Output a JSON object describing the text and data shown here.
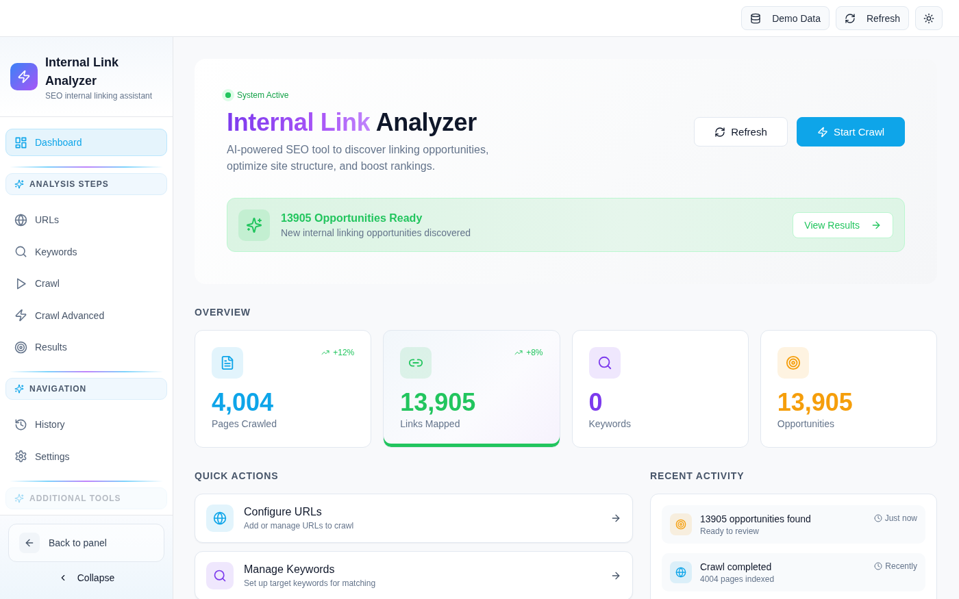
{
  "topbar": {
    "buttons": [
      {
        "kind": "data",
        "label": "Demo Data"
      },
      {
        "kind": "refresh",
        "label": "Refresh"
      },
      {
        "kind": "theme"
      }
    ]
  },
  "sidebar": {
    "brand": {
      "title": "Internal Link Analyzer",
      "subtitle": "SEO internal linking assistant"
    },
    "items": [
      {
        "kind": "dashboard",
        "label": "Dashboard",
        "selected": true
      }
    ],
    "sections": [
      {
        "title": "ANALYSIS STEPS",
        "faded": false,
        "items": [
          {
            "kind": "urls",
            "label": "URLs",
            "selected": false
          },
          {
            "kind": "keywords",
            "label": "Keywords",
            "selected": false
          },
          {
            "kind": "crawl",
            "label": "Crawl",
            "selected": false
          },
          {
            "kind": "crawl_advanced",
            "label": "Crawl Advanced",
            "selected": false
          },
          {
            "kind": "results",
            "label": "Results",
            "selected": false
          }
        ]
      },
      {
        "title": "NAVIGATION",
        "faded": false,
        "items": [
          {
            "kind": "history",
            "label": "History",
            "selected": false
          },
          {
            "kind": "settings",
            "label": "Settings",
            "selected": false
          }
        ]
      },
      {
        "title": "ADDITIONAL TOOLS",
        "faded": true
      }
    ],
    "footer": {
      "back_button": "Back to panel",
      "collapse_button": "Collapse"
    }
  },
  "hero": {
    "status": {
      "label": "System Active",
      "active": true
    },
    "title": {
      "highlight": "Internal Link",
      "rest": "Analyzer"
    },
    "description": "AI-powered SEO tool to discover linking opportunities, optimize site structure, and boost rankings.",
    "buttons": [
      {
        "kind": "secondary",
        "label": "Refresh"
      },
      {
        "kind": "primary",
        "label": "Start Crawl"
      }
    ],
    "banner": {
      "title": "13905 Opportunities Ready",
      "subtitle": "New internal linking opportunities discovered",
      "button": "View Results"
    }
  },
  "overview": {
    "title": "OVERVIEW",
    "cards": [
      {
        "kind": "pages",
        "value": "4,004",
        "label": "Pages Crawled",
        "trend": "+12%",
        "color": "#0ea5e9",
        "highlighted": false
      },
      {
        "kind": "links",
        "value": "13,905",
        "label": "Links Mapped",
        "trend": "+8%",
        "color": "#22c55e",
        "highlighted": true
      },
      {
        "kind": "keywords",
        "value": "0",
        "label": "Keywords",
        "color": "#7c3aed",
        "highlighted": false
      },
      {
        "kind": "opportunities",
        "value": "13,905",
        "label": "Opportunities",
        "color": "#f59e0b",
        "highlighted": false
      }
    ]
  },
  "quick_actions": {
    "title": "QUICK ACTIONS",
    "items": [
      {
        "kind": "urls",
        "title": "Configure URLs",
        "subtitle": "Add or manage URLs to crawl",
        "color": "#0ea5e9"
      },
      {
        "kind": "keywords",
        "title": "Manage Keywords",
        "subtitle": "Set up target keywords for matching",
        "color": "#7c3aed"
      }
    ]
  },
  "recent_activity": {
    "title": "RECENT ACTIVITY",
    "items": [
      {
        "kind": "opportunities",
        "title": "13905 opportunities found",
        "subtitle": "Ready to review",
        "time": "Just now",
        "color": "#f59e0b"
      },
      {
        "kind": "crawl",
        "title": "Crawl completed",
        "subtitle": "4004 pages indexed",
        "time": "Recently",
        "color": "#0ea5e9"
      }
    ]
  }
}
